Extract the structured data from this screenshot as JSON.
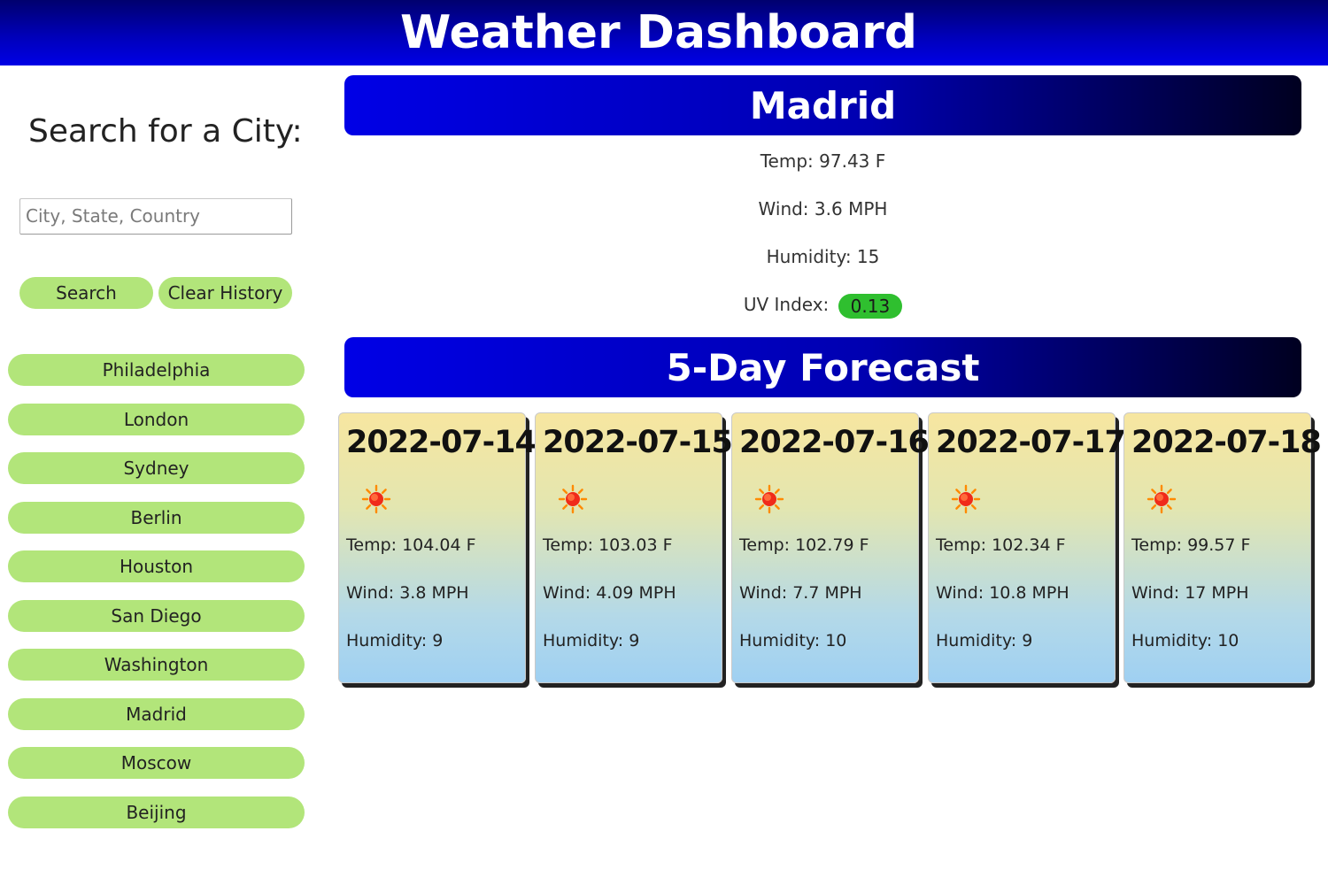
{
  "header": {
    "title": "Weather Dashboard"
  },
  "sidebar": {
    "heading": "Search for a City:",
    "search_placeholder": "City, State, Country",
    "search_value": "",
    "search_label": "Search",
    "clear_label": "Clear History",
    "history": [
      "Philadelphia",
      "London",
      "Sydney",
      "Berlin",
      "Houston",
      "San Diego",
      "Washington",
      "Madrid",
      "Moscow",
      "Beijing"
    ]
  },
  "current": {
    "city": "Madrid",
    "temp": "Temp: 97.43 F",
    "wind": "Wind: 3.6 MPH",
    "humidity": "Humidity: 15",
    "uv_label": "UV Index:",
    "uv_value": "0.13",
    "uv_color": "#2fbf2f"
  },
  "forecast": {
    "title": "5-Day Forecast",
    "days": [
      {
        "date": "2022-07-14",
        "icon": "sun-icon",
        "temp": "Temp: 104.04 F",
        "wind": "Wind: 3.8 MPH",
        "humidity": "Humidity: 9"
      },
      {
        "date": "2022-07-15",
        "icon": "sun-icon",
        "temp": "Temp: 103.03 F",
        "wind": "Wind: 4.09 MPH",
        "humidity": "Humidity: 9"
      },
      {
        "date": "2022-07-16",
        "icon": "sun-icon",
        "temp": "Temp: 102.79 F",
        "wind": "Wind: 7.7 MPH",
        "humidity": "Humidity: 10"
      },
      {
        "date": "2022-07-17",
        "icon": "sun-icon",
        "temp": "Temp: 102.34 F",
        "wind": "Wind: 10.8 MPH",
        "humidity": "Humidity: 9"
      },
      {
        "date": "2022-07-18",
        "icon": "sun-icon",
        "temp": "Temp: 99.57 F",
        "wind": "Wind: 17 MPH",
        "humidity": "Humidity: 10"
      }
    ]
  },
  "colors": {
    "header_blue": "#0000e6",
    "pill_green": "#b2e57a",
    "uv_green": "#2fbf2f"
  }
}
